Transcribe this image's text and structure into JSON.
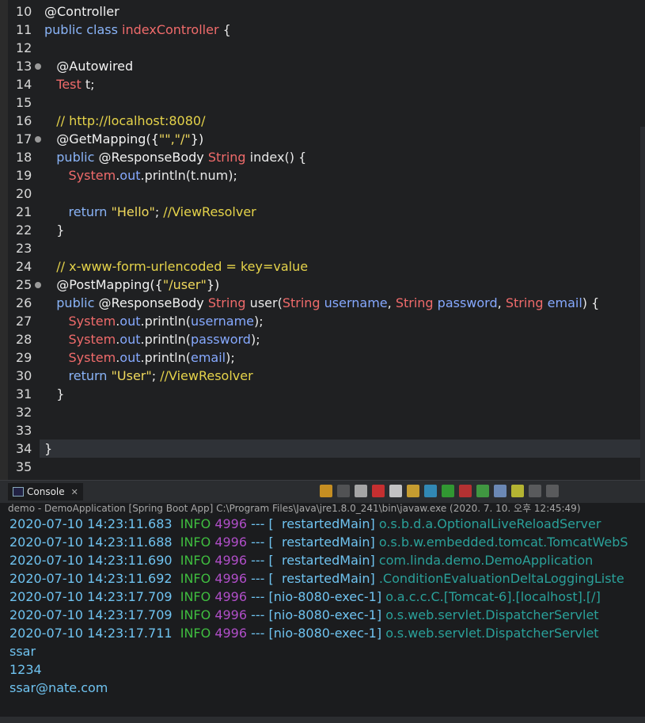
{
  "editor": {
    "lines": [
      {
        "n": "10",
        "fold": false,
        "parts": [
          [
            "ann",
            "@Controller"
          ]
        ]
      },
      {
        "n": "11",
        "fold": false,
        "parts": [
          [
            "kw",
            "public "
          ],
          [
            "kw",
            "class "
          ],
          [
            "cls",
            "indexController "
          ],
          [
            "plain",
            "{"
          ]
        ]
      },
      {
        "n": "12",
        "fold": false,
        "parts": []
      },
      {
        "n": "13",
        "fold": true,
        "parts": [
          [
            "plain",
            "   "
          ],
          [
            "ann",
            "@Autowired"
          ]
        ]
      },
      {
        "n": "14",
        "fold": false,
        "parts": [
          [
            "plain",
            "   "
          ],
          [
            "type",
            "Test "
          ],
          [
            "plain",
            "t;"
          ]
        ]
      },
      {
        "n": "15",
        "fold": false,
        "parts": []
      },
      {
        "n": "16",
        "fold": false,
        "parts": [
          [
            "plain",
            "   "
          ],
          [
            "cm",
            "// http://localhost:8080/"
          ]
        ]
      },
      {
        "n": "17",
        "fold": true,
        "parts": [
          [
            "plain",
            "   "
          ],
          [
            "ann",
            "@GetMapping({"
          ],
          [
            "str",
            "\"\",\"/\""
          ],
          [
            "ann",
            "})"
          ]
        ]
      },
      {
        "n": "18",
        "fold": false,
        "parts": [
          [
            "plain",
            "   "
          ],
          [
            "kw",
            "public "
          ],
          [
            "ann",
            "@ResponseBody "
          ],
          [
            "type",
            "String "
          ],
          [
            "plain",
            "index() {"
          ]
        ]
      },
      {
        "n": "19",
        "fold": false,
        "parts": [
          [
            "plain",
            "      "
          ],
          [
            "type",
            "System"
          ],
          [
            "plain",
            "."
          ],
          [
            "fld",
            "out"
          ],
          [
            "plain",
            ".println(t.num);"
          ]
        ]
      },
      {
        "n": "20",
        "fold": false,
        "parts": []
      },
      {
        "n": "21",
        "fold": false,
        "parts": [
          [
            "plain",
            "      "
          ],
          [
            "kw",
            "return "
          ],
          [
            "str",
            "\"Hello\""
          ],
          [
            "plain",
            "; "
          ],
          [
            "cm",
            "//ViewResolver"
          ]
        ]
      },
      {
        "n": "22",
        "fold": false,
        "parts": [
          [
            "plain",
            "   }"
          ]
        ]
      },
      {
        "n": "23",
        "fold": false,
        "parts": []
      },
      {
        "n": "24",
        "fold": false,
        "parts": [
          [
            "plain",
            "   "
          ],
          [
            "cm",
            "// x-www-form-urlencoded = key=value"
          ]
        ]
      },
      {
        "n": "25",
        "fold": true,
        "parts": [
          [
            "plain",
            "   "
          ],
          [
            "ann",
            "@PostMapping({"
          ],
          [
            "str",
            "\"/user\""
          ],
          [
            "ann",
            "})"
          ]
        ]
      },
      {
        "n": "26",
        "fold": false,
        "parts": [
          [
            "plain",
            "   "
          ],
          [
            "kw",
            "public "
          ],
          [
            "ann",
            "@ResponseBody "
          ],
          [
            "type",
            "String "
          ],
          [
            "plain",
            "user("
          ],
          [
            "type",
            "String "
          ],
          [
            "fld",
            "username"
          ],
          [
            "plain",
            ", "
          ],
          [
            "type",
            "String "
          ],
          [
            "fld",
            "password"
          ],
          [
            "plain",
            ", "
          ],
          [
            "type",
            "String "
          ],
          [
            "fld",
            "email"
          ],
          [
            "plain",
            ") {"
          ]
        ]
      },
      {
        "n": "27",
        "fold": false,
        "parts": [
          [
            "plain",
            "      "
          ],
          [
            "type",
            "System"
          ],
          [
            "plain",
            "."
          ],
          [
            "fld",
            "out"
          ],
          [
            "plain",
            ".println("
          ],
          [
            "fld",
            "username"
          ],
          [
            "plain",
            ");"
          ]
        ]
      },
      {
        "n": "28",
        "fold": false,
        "parts": [
          [
            "plain",
            "      "
          ],
          [
            "type",
            "System"
          ],
          [
            "plain",
            "."
          ],
          [
            "fld",
            "out"
          ],
          [
            "plain",
            ".println("
          ],
          [
            "fld",
            "password"
          ],
          [
            "plain",
            ");"
          ]
        ]
      },
      {
        "n": "29",
        "fold": false,
        "parts": [
          [
            "plain",
            "      "
          ],
          [
            "type",
            "System"
          ],
          [
            "plain",
            "."
          ],
          [
            "fld",
            "out"
          ],
          [
            "plain",
            ".println("
          ],
          [
            "fld",
            "email"
          ],
          [
            "plain",
            ");"
          ]
        ]
      },
      {
        "n": "30",
        "fold": false,
        "parts": [
          [
            "plain",
            "      "
          ],
          [
            "kw",
            "return "
          ],
          [
            "str",
            "\"User\""
          ],
          [
            "plain",
            "; "
          ],
          [
            "cm",
            "//ViewResolver"
          ]
        ]
      },
      {
        "n": "31",
        "fold": false,
        "parts": [
          [
            "plain",
            "   }"
          ]
        ]
      },
      {
        "n": "32",
        "fold": false,
        "parts": []
      },
      {
        "n": "33",
        "fold": false,
        "parts": []
      },
      {
        "n": "34",
        "fold": false,
        "current": true,
        "parts": [
          [
            "plain",
            "}"
          ]
        ]
      },
      {
        "n": "35",
        "fold": false,
        "parts": []
      }
    ]
  },
  "console": {
    "tab_label": "Console",
    "tab_close": "✕",
    "status": "demo - DemoApplication [Spring Boot App] C:\\Program Files\\Java\\jre1.8.0_241\\bin\\javaw.exe (2020. 7. 10. 오후 12:45:49)",
    "logs": [
      {
        "ts": "2020-07-10 14:23:11.683",
        "lvl": "INFO",
        "pid": "4996",
        "dash": "---",
        "thr": "[  restartedMain]",
        "lgr": "o.s.b.d.a.OptionalLiveReloadServer"
      },
      {
        "ts": "2020-07-10 14:23:11.688",
        "lvl": "INFO",
        "pid": "4996",
        "dash": "---",
        "thr": "[  restartedMain]",
        "lgr": "o.s.b.w.embedded.tomcat.TomcatWebS"
      },
      {
        "ts": "2020-07-10 14:23:11.690",
        "lvl": "INFO",
        "pid": "4996",
        "dash": "---",
        "thr": "[  restartedMain]",
        "lgr": "com.linda.demo.DemoApplication"
      },
      {
        "ts": "2020-07-10 14:23:11.692",
        "lvl": "INFO",
        "pid": "4996",
        "dash": "---",
        "thr": "[  restartedMain]",
        "lgr": ".ConditionEvaluationDeltaLoggingListe"
      },
      {
        "ts": "2020-07-10 14:23:17.709",
        "lvl": "INFO",
        "pid": "4996",
        "dash": "---",
        "thr": "[nio-8080-exec-1]",
        "lgr": "o.a.c.c.C.[Tomcat-6].[localhost].[/]"
      },
      {
        "ts": "2020-07-10 14:23:17.709",
        "lvl": "INFO",
        "pid": "4996",
        "dash": "---",
        "thr": "[nio-8080-exec-1]",
        "lgr": "o.s.web.servlet.DispatcherServlet"
      },
      {
        "ts": "2020-07-10 14:23:17.711",
        "lvl": "INFO",
        "pid": "4996",
        "dash": "---",
        "thr": "[nio-8080-exec-1]",
        "lgr": "o.s.web.servlet.DispatcherServlet"
      }
    ],
    "output": [
      "ssar",
      "1234",
      "ssar@nate.com"
    ]
  },
  "toolbar_icons": [
    "refresh-icon",
    "remove-launch-icon",
    "remove-all-icon",
    "terminate-icon",
    "clear-console-icon",
    "scroll-lock-icon",
    "word-wrap-icon",
    "show-on-stdout-icon",
    "show-on-stderr-icon",
    "pin-console-icon",
    "display-console-icon",
    "open-console-icon",
    "minimize-icon",
    "maximize-icon"
  ],
  "colors": {
    "editor_bg": "#1f2022",
    "console_bg": "#1b1c1e",
    "info": "#3fbd3f",
    "pid": "#b04ec8",
    "timestamp": "#6fc3f0",
    "logger": "#2aa19a"
  }
}
